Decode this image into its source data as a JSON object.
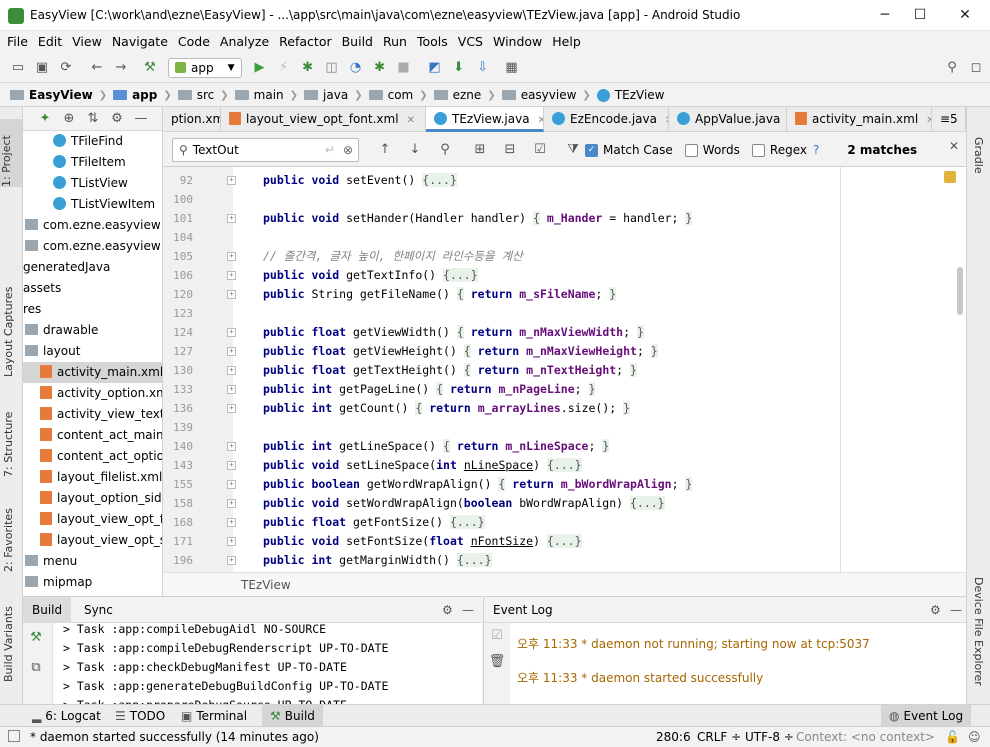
{
  "window": {
    "title": "EasyView [C:\\work\\and\\ezne\\EasyView] - ...\\app\\src\\main\\java\\com\\ezne\\easyview\\TEzView.java [app] - Android Studio",
    "minimize": "─",
    "maximize": "☐",
    "close": "✕"
  },
  "menu": [
    "File",
    "Edit",
    "View",
    "Navigate",
    "Code",
    "Analyze",
    "Refactor",
    "Build",
    "Run",
    "Tools",
    "VCS",
    "Window",
    "Help"
  ],
  "toolbar": {
    "run_config": "app"
  },
  "breadcrumb": [
    "EasyView",
    "app",
    "src",
    "main",
    "java",
    "com",
    "ezne",
    "easyview",
    "TEzView"
  ],
  "left_tools": [
    "1: Project",
    "Layout Captures",
    "7: Structure",
    "2: Favorites",
    "Build Variants"
  ],
  "right_tools": [
    "Gradle",
    "Device File Explorer"
  ],
  "project_tree": [
    {
      "label": "TFileFind",
      "type": "class",
      "indent": 2
    },
    {
      "label": "TFileItem",
      "type": "class",
      "indent": 2
    },
    {
      "label": "TListView",
      "type": "class",
      "indent": 2
    },
    {
      "label": "TListViewItem",
      "type": "class",
      "indent": 2
    },
    {
      "label": "com.ezne.easyview (an",
      "type": "folder",
      "indent": 0
    },
    {
      "label": "com.ezne.easyview (te",
      "type": "folder",
      "indent": 0
    },
    {
      "label": "generatedJava",
      "type": "none",
      "indent": 0
    },
    {
      "label": "assets",
      "type": "none",
      "indent": 0
    },
    {
      "label": "res",
      "type": "none",
      "indent": 0
    },
    {
      "label": "drawable",
      "type": "folder",
      "indent": 0
    },
    {
      "label": "layout",
      "type": "folder",
      "indent": 0
    },
    {
      "label": "activity_main.xml",
      "type": "xml",
      "indent": 1,
      "selected": true
    },
    {
      "label": "activity_option.xml",
      "type": "xml",
      "indent": 1
    },
    {
      "label": "activity_view_text.xm",
      "type": "xml",
      "indent": 1
    },
    {
      "label": "content_act_main.x",
      "type": "xml",
      "indent": 1
    },
    {
      "label": "content_act_option.",
      "type": "xml",
      "indent": 1
    },
    {
      "label": "layout_filelist.xml",
      "type": "xml",
      "indent": 1
    },
    {
      "label": "layout_option_side.x",
      "type": "xml",
      "indent": 1
    },
    {
      "label": "layout_view_opt_for",
      "type": "xml",
      "indent": 1
    },
    {
      "label": "layout_view_opt_sid",
      "type": "xml",
      "indent": 1
    },
    {
      "label": "menu",
      "type": "folder",
      "indent": 0
    },
    {
      "label": "mipmap",
      "type": "folder",
      "indent": 0
    }
  ],
  "editor_tabs": [
    {
      "label": "ption.xml",
      "active": false
    },
    {
      "label": "layout_view_opt_font.xml",
      "active": false
    },
    {
      "label": "TEzView.java",
      "active": true
    },
    {
      "label": "EzEncode.java",
      "active": false
    },
    {
      "label": "AppValue.java",
      "active": false
    },
    {
      "label": "activity_main.xml",
      "active": false
    },
    {
      "label": "≡5",
      "active": false
    }
  ],
  "find": {
    "query": "TextOut",
    "match_case_label": "Match Case",
    "match_case": true,
    "words_label": "Words",
    "regex_label": "Regex",
    "regex_help": "?",
    "matches": "2 matches"
  },
  "code_lines": [
    {
      "n": "92",
      "html": "<span class=\"kw\">public void</span> setEvent() <span class=\"fo\">{...}</span>"
    },
    {
      "n": "100",
      "html": ""
    },
    {
      "n": "101",
      "html": "<span class=\"kw\">public void</span> setHander(Handler handler) <span class=\"fo\">{</span> <span class=\"fd\">m_Hander</span> = handler; <span class=\"fo\">}</span>"
    },
    {
      "n": "104",
      "html": ""
    },
    {
      "n": "105",
      "html": "<span class=\"cm\">// 줄간격, 글자 높이, 한페이지 라인수등을 계산</span>"
    },
    {
      "n": "106",
      "html": "<span class=\"kw\">public void</span> getTextInfo() <span class=\"fo\">{...}</span>"
    },
    {
      "n": "120",
      "html": "<span class=\"kw\">public</span> String getFileName() <span class=\"fo\">{</span> <span class=\"kw\">return</span> <span class=\"fd\">m_sFileName</span>; <span class=\"fo\">}</span>"
    },
    {
      "n": "123",
      "html": ""
    },
    {
      "n": "124",
      "html": "<span class=\"kw\">public float</span> getViewWidth() <span class=\"fo\">{</span> <span class=\"kw\">return</span>  <span class=\"fd\">m_nMaxViewWidth</span>; <span class=\"fo\">}</span>"
    },
    {
      "n": "127",
      "html": "<span class=\"kw\">public float</span> getViewHeight() <span class=\"fo\">{</span> <span class=\"kw\">return</span>  <span class=\"fd\">m_nMaxViewHeight</span>; <span class=\"fo\">}</span>"
    },
    {
      "n": "130",
      "html": "<span class=\"kw\">public float</span> getTextHeight() <span class=\"fo\">{</span> <span class=\"kw\">return</span>  <span class=\"fd\">m_nTextHeight</span>; <span class=\"fo\">}</span>"
    },
    {
      "n": "133",
      "html": "<span class=\"kw\">public int</span> getPageLine() <span class=\"fo\">{</span> <span class=\"kw\">return</span>  <span class=\"fd\">m_nPageLine</span>; <span class=\"fo\">}</span>"
    },
    {
      "n": "136",
      "html": "<span class=\"kw\">public int</span> getCount() <span class=\"fo\">{</span> <span class=\"kw\">return</span>  <span class=\"fd\">m_arrayLines</span>.size(); <span class=\"fo\">}</span>"
    },
    {
      "n": "139",
      "html": ""
    },
    {
      "n": "140",
      "html": "<span class=\"kw\">public int</span> getLineSpace() <span class=\"fo\">{</span> <span class=\"kw\">return</span>  <span class=\"fd\">m_nLineSpace</span>; <span class=\"fo\">}</span>"
    },
    {
      "n": "143",
      "html": "<span class=\"kw\">public void</span> setLineSpace(<span class=\"kw\">int</span> <u>nLineSpace</u>) <span class=\"fo\">{...}</span>"
    },
    {
      "n": "155",
      "html": "<span class=\"kw\">public boolean</span> getWordWrapAlign() <span class=\"fo\">{</span> <span class=\"kw\">return</span>  <span class=\"fd\">m_bWordWrapAlign</span>; <span class=\"fo\">}</span>"
    },
    {
      "n": "158",
      "html": "<span class=\"kw\">public void</span> setWordWrapAlign(<span class=\"kw\">boolean</span> bWordWrapAlign) <span class=\"fo\">{...}</span>"
    },
    {
      "n": "168",
      "html": "<span class=\"kw\">public float</span> getFontSize() <span class=\"fo\">{...}</span>"
    },
    {
      "n": "171",
      "html": "<span class=\"kw\">public void</span> setFontSize(<span class=\"kw\">float</span> <u>nFontSize</u>) <span class=\"fo\">{...}</span>"
    },
    {
      "n": "196",
      "html": "<span class=\"kw\">public int</span> getMarginWidth() <span class=\"fo\">{...}</span>"
    }
  ],
  "editor_breadcrumb": "TEzView",
  "build_panel": {
    "tabs": [
      "Build",
      "Sync"
    ],
    "lines": [
      "> Task :app:compileDebugAidl NO-SOURCE",
      "> Task :app:compileDebugRenderscript UP-TO-DATE",
      "> Task :app:checkDebugManifest UP-TO-DATE",
      "> Task :app:generateDebugBuildConfig UP-TO-DATE",
      "> Task :app:prepareDebugSource UP-TO-DATE"
    ]
  },
  "event_log": {
    "title": "Event Log",
    "entries": [
      "오후 11:33 * daemon not running; starting now at tcp:5037",
      "오후 11:33 * daemon started successfully"
    ]
  },
  "bottom_tabs": [
    "6: Logcat",
    "TODO",
    "Terminal",
    "Build",
    "Event Log"
  ],
  "status": {
    "message": "* daemon started successfully (14 minutes ago)",
    "position": "280:6",
    "line_sep": "CRLF ÷",
    "encoding": "UTF-8 ÷",
    "context": "Context: <no context>"
  }
}
